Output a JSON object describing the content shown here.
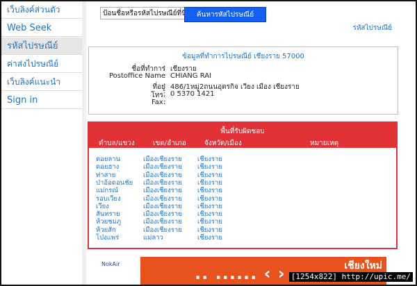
{
  "sidebar": {
    "items": [
      {
        "label": "เว็บลิงค์ส่วนตัว",
        "active": false
      },
      {
        "label": "Web Seek",
        "active": false
      },
      {
        "label": "รหัสไปรษณีย์",
        "active": true
      },
      {
        "label": "ค่าส่งไปรษณีย์",
        "active": false
      },
      {
        "label": "เว็บลิงค์แนะนำ",
        "active": false
      },
      {
        "label": "Sign in",
        "active": false
      }
    ]
  },
  "search": {
    "input_value": "ป้อนชื่อหรือรหัสไปรษณีย์ที่นี่",
    "button_label": "ค้นหารหัสไปรษณีย์"
  },
  "top_link": "รหัสไปรษณีย์",
  "postoffice": {
    "title": "ข้อมูลที่ทำการไปรษณีย์ เชียงราย 57000",
    "rows": [
      {
        "label": "ชื่อที่ทำการ",
        "value": "เชียงราย"
      },
      {
        "label": "Postoffice Name",
        "value": "CHIANG RAI"
      },
      {
        "label": "ที่อยู่",
        "value": "486/1หมู่2ถนนอุตรกิจ เวียง เมือง เชียงราย"
      },
      {
        "label": "โทร.",
        "value": "0 5370 1421"
      },
      {
        "label": "Fax.",
        "value": ""
      }
    ]
  },
  "area": {
    "title": "พื้นที่รับผิดชอบ",
    "headers": [
      "ตำบล/แขวง",
      "เขต/อำเภอ",
      "จังหวัด/เมือง",
      "หมายเหตุ"
    ],
    "rows": [
      [
        "ดอยลาน",
        "เมืองเชียงราย",
        "เชียงราย"
      ],
      [
        "ดอยฮาง",
        "เมืองเชียงราย",
        "เชียงราย"
      ],
      [
        "ท่าสาย",
        "เมืองเชียงราย",
        "เชียงราย"
      ],
      [
        "ป่าอ้อดอนชัย",
        "เมืองเชียงราย",
        "เชียงราย"
      ],
      [
        "แม่กรณ์",
        "เมืองเชียงราย",
        "เชียงราย"
      ],
      [
        "รอบเวียง",
        "เมืองเชียงราย",
        "เชียงราย"
      ],
      [
        "เวียง",
        "เมืองเชียงราย",
        "เชียงราย"
      ],
      [
        "สันทราย",
        "เมืองเชียงราย",
        "เชียงราย"
      ],
      [
        "ห้วยชมภู",
        "เมืองเชียงราย",
        "เชียงราย"
      ],
      [
        "ห้วยสัก",
        "เมืองเชียงราย",
        "เชียงราย"
      ],
      [
        "โป่งแพร่",
        "แม่ลาว",
        "เชียงราย"
      ]
    ]
  },
  "banner": {
    "logo_text": "NokAir",
    "right_text": "เชียงใหม่"
  },
  "stamp": "[1254x822] http://upic.me/",
  "colors": {
    "accent": "#1b73c8",
    "button": "#1460f5",
    "table_header": "#e23238",
    "banner": "#e8521c"
  }
}
